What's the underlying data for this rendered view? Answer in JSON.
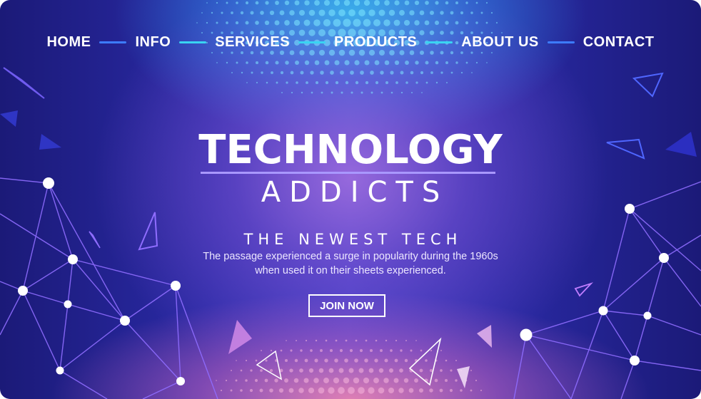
{
  "nav": {
    "items": [
      {
        "label": "HOME"
      },
      {
        "label": "INFO"
      },
      {
        "label": "SERVICES"
      },
      {
        "label": "PRODUCTS"
      },
      {
        "label": "ABOUT US"
      },
      {
        "label": "CONTACT"
      }
    ],
    "separator_colors": [
      "#3d7cff",
      "#39d4f2",
      "#39d4f2",
      "#39d4f2",
      "#3d7cff"
    ]
  },
  "hero": {
    "title": "TECHNOLOGY",
    "subtitle": "ADDICTS",
    "tagline": "THE NEWEST TECH",
    "description": "The passage experienced a surge in popularity during the 1960s when used it on their sheets experienced.",
    "cta_label": "JOIN NOW",
    "title_underline_color": "#a998ff"
  },
  "background": {
    "base_color": "#1b1a78",
    "glow_top_color": "#28c8f0",
    "glow_center_color": "#b478e6",
    "glow_bottom_color": "#e682b4",
    "network_line_color": "#8f6dff",
    "node_color": "#ffffff"
  }
}
